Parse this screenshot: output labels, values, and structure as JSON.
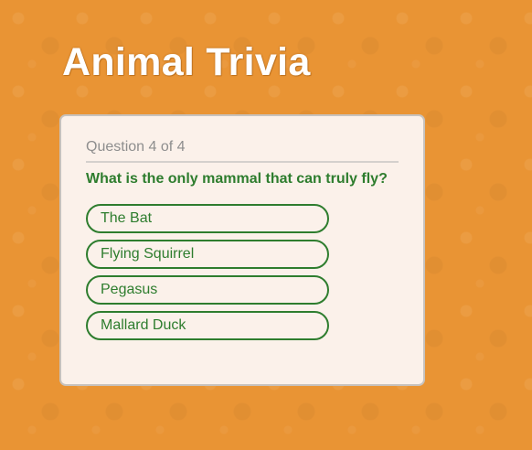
{
  "app": {
    "title": "Animal Trivia"
  },
  "quiz": {
    "counter_text": "Question 4 of 4",
    "current_question": 4,
    "total_questions": 4,
    "question": "What is the only mammal that can truly fly?",
    "options": [
      "The Bat",
      "Flying Squirrel",
      "Pegasus",
      "Mallard Duck"
    ]
  },
  "colors": {
    "background": "#E99434",
    "card": "#FBF1EA",
    "accent_green": "#2E7D2E",
    "counter_gray": "#8E8E8E"
  }
}
